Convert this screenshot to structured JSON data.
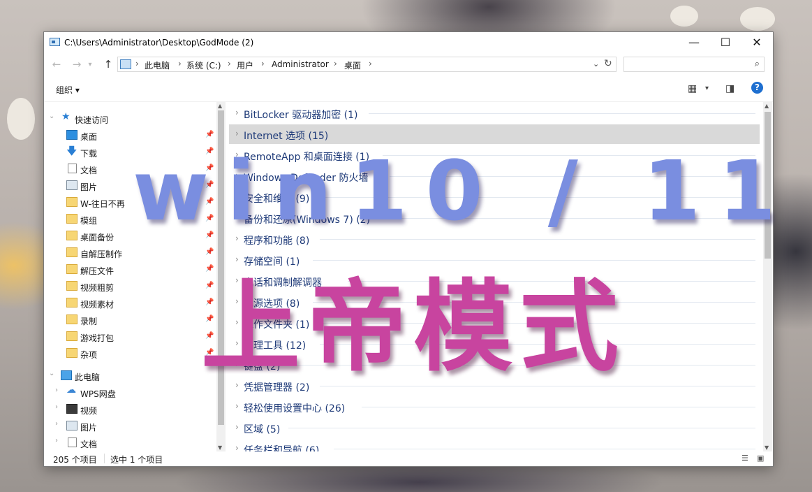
{
  "window": {
    "title": "C:\\Users\\Administrator\\Desktop\\GodMode (2)",
    "minimize": "—",
    "maximize": "☐",
    "close": "✕"
  },
  "address": {
    "breadcrumbs": [
      "此电脑",
      "系统 (C:)",
      "用户",
      "Administrator",
      "桌面"
    ],
    "search_placeholder": ""
  },
  "toolbar": {
    "organize": "组织 ▾"
  },
  "nav": {
    "quick_access": "快速访问",
    "quick_items": [
      {
        "label": "桌面",
        "icon": "desktop-icon"
      },
      {
        "label": "下载",
        "icon": "download-icon"
      },
      {
        "label": "文档",
        "icon": "document-icon"
      },
      {
        "label": "图片",
        "icon": "pictures-icon"
      },
      {
        "label": "W-往日不再",
        "icon": "folder-icon"
      },
      {
        "label": "模组",
        "icon": "folder-icon"
      },
      {
        "label": "桌面备份",
        "icon": "folder-icon"
      },
      {
        "label": "自解压制作",
        "icon": "folder-icon"
      },
      {
        "label": "解压文件",
        "icon": "folder-icon"
      },
      {
        "label": "视频粗剪",
        "icon": "folder-icon"
      },
      {
        "label": "视频素材",
        "icon": "folder-icon"
      },
      {
        "label": "录制",
        "icon": "folder-icon"
      },
      {
        "label": "游戏打包",
        "icon": "folder-icon"
      },
      {
        "label": "杂项",
        "icon": "folder-icon"
      }
    ],
    "this_pc": "此电脑",
    "pc_items": [
      {
        "label": "WPS网盘",
        "icon": "cloud-icon"
      },
      {
        "label": "视频",
        "icon": "video-icon"
      },
      {
        "label": "图片",
        "icon": "pictures-icon"
      },
      {
        "label": "文档",
        "icon": "document-icon"
      }
    ]
  },
  "groups": [
    "BitLocker 驱动器加密 (1)",
    "Internet 选项 (15)",
    "RemoteApp 和桌面连接 (1)",
    "Windows Defender 防火墙",
    "安全和维护 (9)",
    "备份和还原(Windows 7) (2)",
    "程序和功能 (8)",
    "存储空间 (1)",
    "电话和调制解调器",
    "电源选项 (8)",
    "工作文件夹 (1)",
    "管理工具 (12)",
    "键盘 (2)",
    "凭据管理器 (2)",
    "轻松使用设置中心 (26)",
    "区域 (5)",
    "任务栏和导航 (6)"
  ],
  "status": {
    "item_count": "205 个项目",
    "selected": "选中 1 个项目"
  },
  "overlay": {
    "line1": "win10 / 11",
    "line2": "上帝模式"
  }
}
